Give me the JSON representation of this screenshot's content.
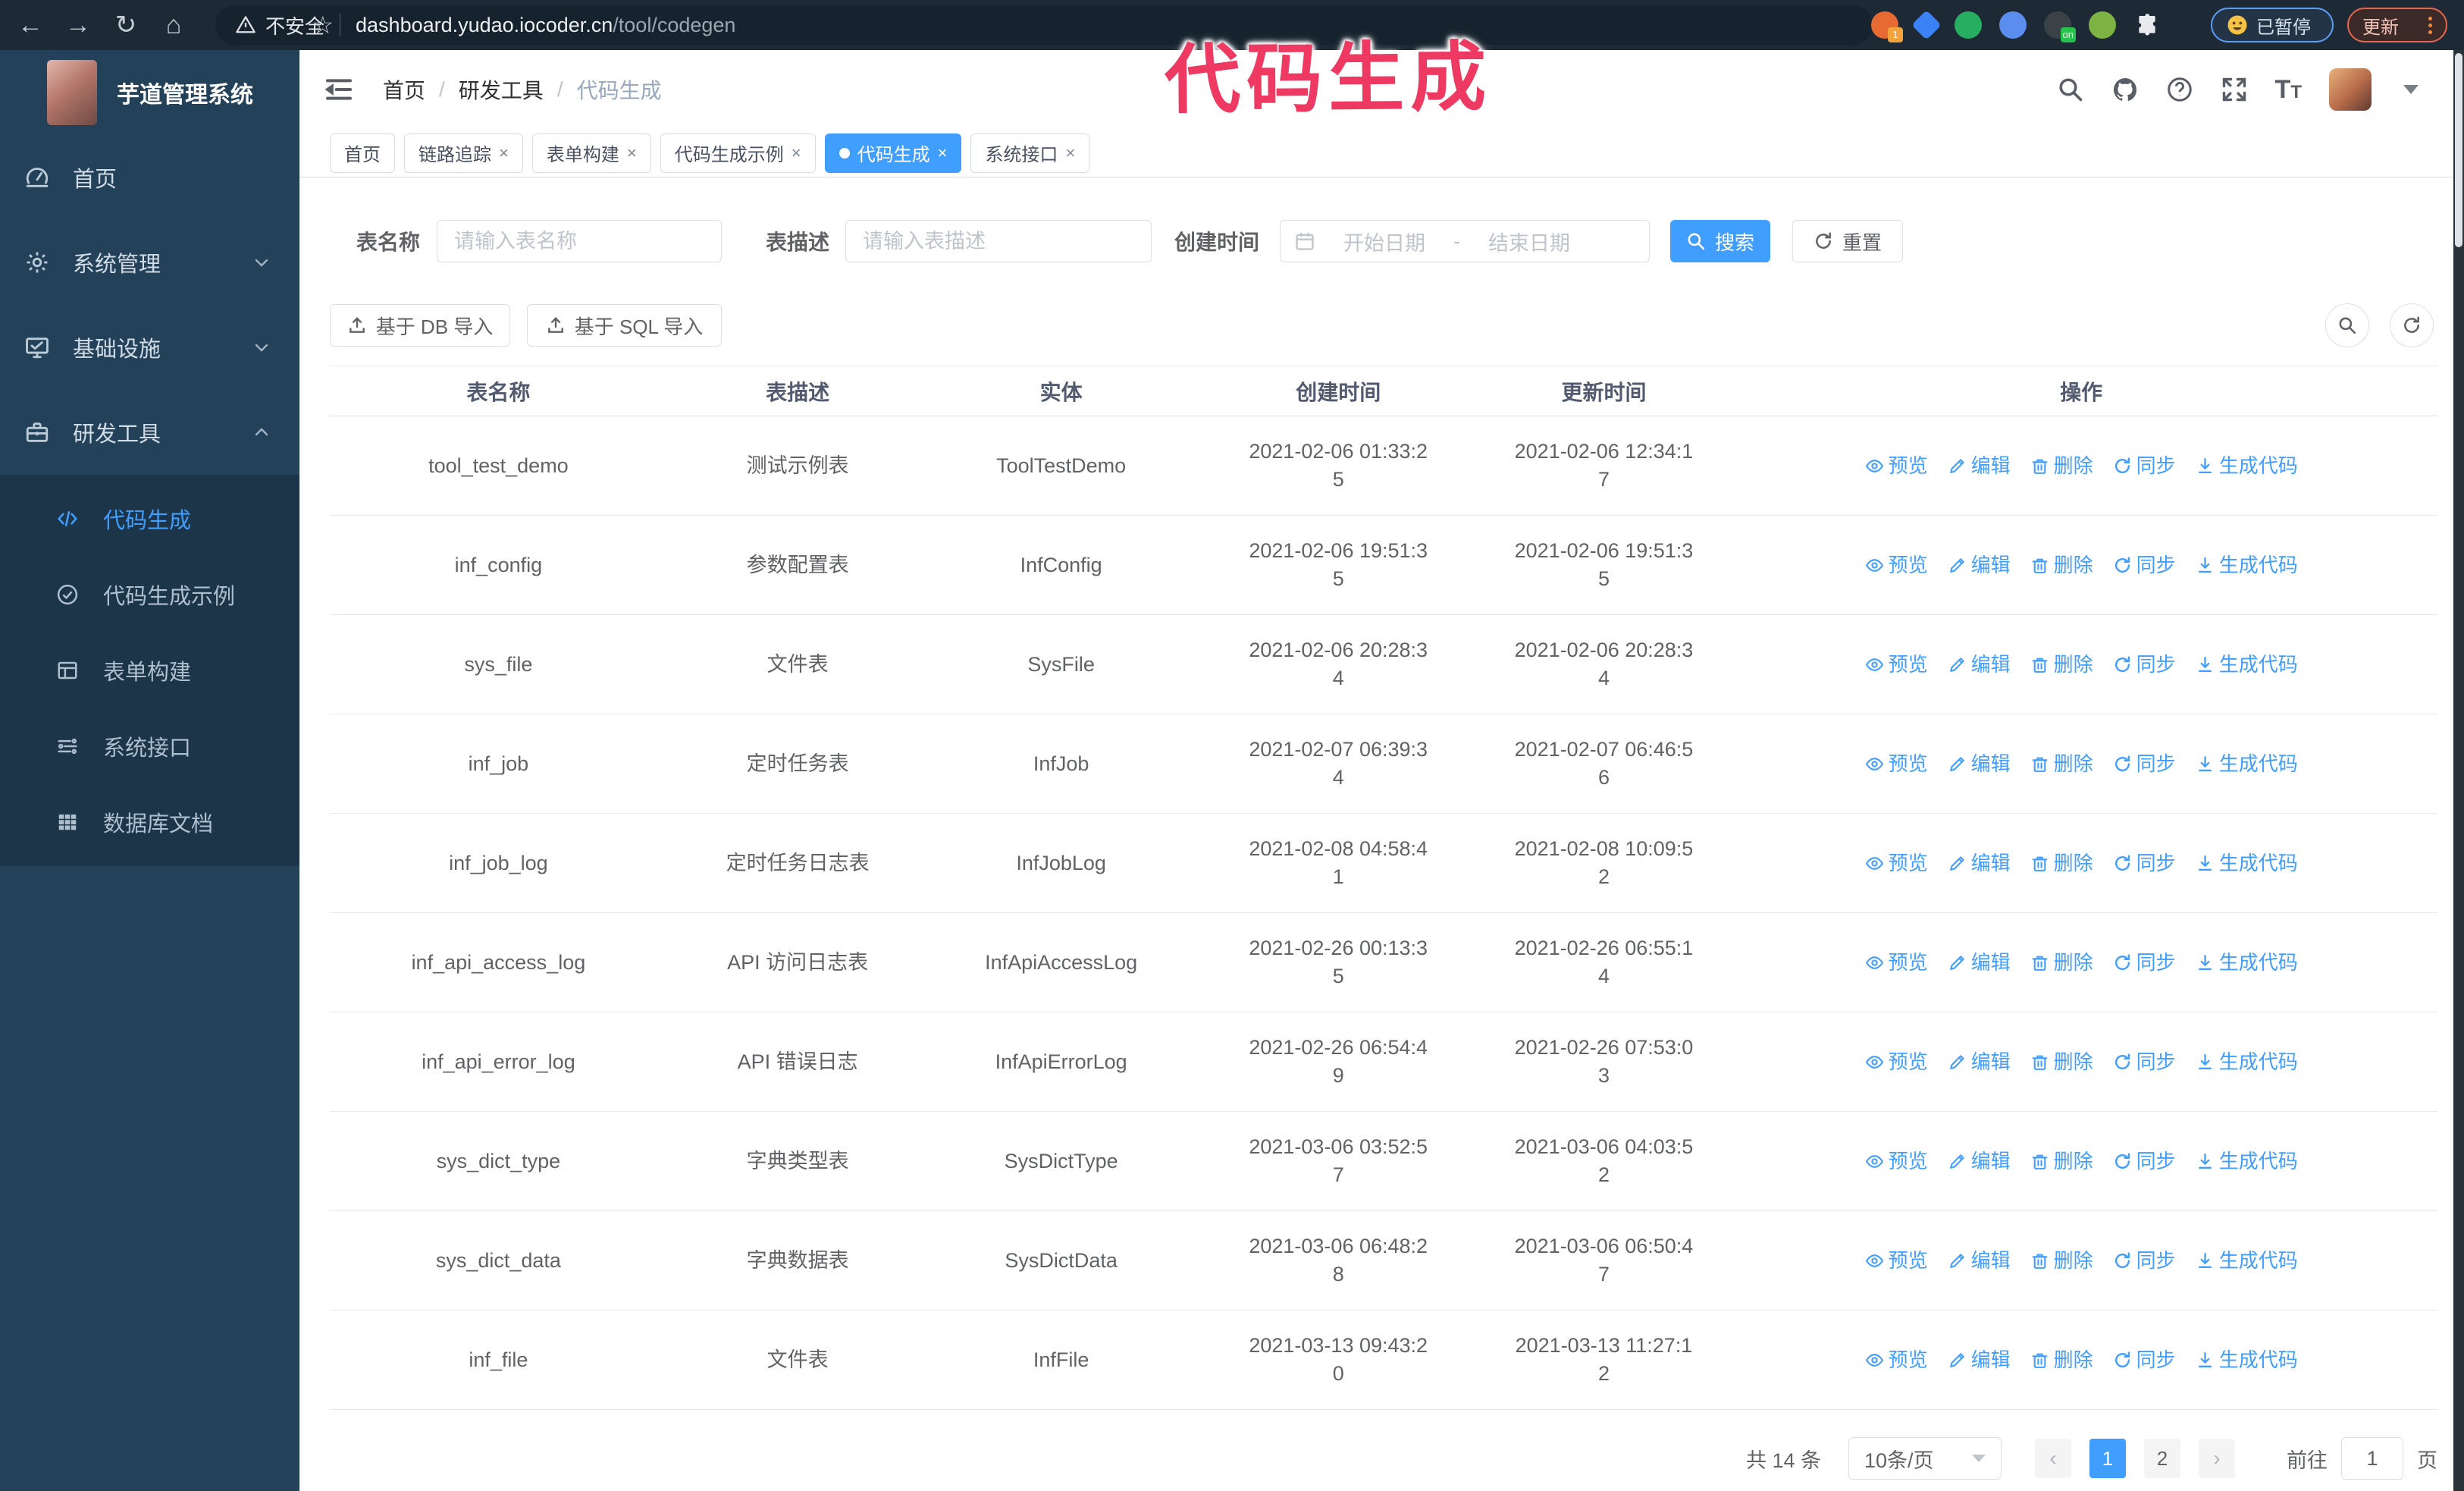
{
  "browser": {
    "security_label": "不安全",
    "url_host": "dashboard.yudao.iocoder.cn",
    "url_path": "/tool/codegen",
    "paused_badge": "已暂停",
    "update_button": "更新",
    "extension_icons": [
      {
        "name": "orange-circle-extension-icon",
        "color": "#e86a33",
        "badge": "1",
        "badge_color": "#f2a33c"
      },
      {
        "name": "blue-gem-extension-icon",
        "color": "#3b82f6",
        "badge": "",
        "badge_color": ""
      },
      {
        "name": "green-check-extension-icon",
        "color": "#27ae60",
        "badge": "",
        "badge_color": ""
      },
      {
        "name": "blue-grid-extension-icon",
        "color": "#5b8def",
        "badge": "",
        "badge_color": ""
      },
      {
        "name": "dark-proxy-extension-icon",
        "color": "#3a4248",
        "badge": "on",
        "badge_color": "#27c24c"
      },
      {
        "name": "green-robot-extension-icon",
        "color": "#7cb342",
        "badge": "",
        "badge_color": ""
      },
      {
        "name": "puzzle-extensions-icon",
        "color": "#e8eaed",
        "badge": "",
        "badge_color": ""
      }
    ]
  },
  "annotation": {
    "text": "代码生成",
    "color": "#ee3a63"
  },
  "sidebar": {
    "app_title": "芋道管理系统",
    "items": [
      {
        "label": "首页"
      },
      {
        "label": "系统管理"
      },
      {
        "label": "基础设施"
      },
      {
        "label": "研发工具"
      }
    ],
    "submenu": [
      {
        "label": "代码生成",
        "active": true
      },
      {
        "label": "代码生成示例"
      },
      {
        "label": "表单构建"
      },
      {
        "label": "系统接口"
      },
      {
        "label": "数据库文档"
      }
    ]
  },
  "header": {
    "breadcrumb": [
      "首页",
      "研发工具",
      "代码生成"
    ]
  },
  "tabs": [
    {
      "label": "首页",
      "active": false,
      "closable": false
    },
    {
      "label": "链路追踪",
      "active": false,
      "closable": true
    },
    {
      "label": "表单构建",
      "active": false,
      "closable": true
    },
    {
      "label": "代码生成示例",
      "active": false,
      "closable": true
    },
    {
      "label": "代码生成",
      "active": true,
      "closable": true
    },
    {
      "label": "系统接口",
      "active": false,
      "closable": true
    }
  ],
  "filters": {
    "name_label": "表名称",
    "name_placeholder": "请输入表名称",
    "desc_label": "表描述",
    "desc_placeholder": "请输入表描述",
    "time_label": "创建时间",
    "start_placeholder": "开始日期",
    "range_separator": "-",
    "end_placeholder": "结束日期",
    "search_label": "搜索",
    "reset_label": "重置"
  },
  "toolbar": {
    "import_db": "基于 DB 导入",
    "import_sql": "基于 SQL 导入"
  },
  "table": {
    "columns": [
      "表名称",
      "表描述",
      "实体",
      "创建时间",
      "更新时间",
      "操作"
    ],
    "actions": [
      "预览",
      "编辑",
      "删除",
      "同步",
      "生成代码"
    ],
    "action_icons": [
      "eye-icon",
      "edit-icon",
      "trash-icon",
      "sync-icon",
      "download-icon"
    ],
    "action_names": [
      "action-preview",
      "action-edit",
      "action-delete",
      "action-sync",
      "action-generate-code"
    ],
    "rows": [
      {
        "name": "tool_test_demo",
        "desc": "测试示例表",
        "entity": "ToolTestDemo",
        "create_time": "2021-02-06 01:33:25",
        "update_time": "2021-02-06 12:34:17"
      },
      {
        "name": "inf_config",
        "desc": "参数配置表",
        "entity": "InfConfig",
        "create_time": "2021-02-06 19:51:35",
        "update_time": "2021-02-06 19:51:35"
      },
      {
        "name": "sys_file",
        "desc": "文件表",
        "entity": "SysFile",
        "create_time": "2021-02-06 20:28:34",
        "update_time": "2021-02-06 20:28:34"
      },
      {
        "name": "inf_job",
        "desc": "定时任务表",
        "entity": "InfJob",
        "create_time": "2021-02-07 06:39:34",
        "update_time": "2021-02-07 06:46:56"
      },
      {
        "name": "inf_job_log",
        "desc": "定时任务日志表",
        "entity": "InfJobLog",
        "create_time": "2021-02-08 04:58:41",
        "update_time": "2021-02-08 10:09:52"
      },
      {
        "name": "inf_api_access_log",
        "desc": "API 访问日志表",
        "entity": "InfApiAccessLog",
        "create_time": "2021-02-26 00:13:35",
        "update_time": "2021-02-26 06:55:14"
      },
      {
        "name": "inf_api_error_log",
        "desc": "API 错误日志",
        "entity": "InfApiErrorLog",
        "create_time": "2021-02-26 06:54:49",
        "update_time": "2021-02-26 07:53:03"
      },
      {
        "name": "sys_dict_type",
        "desc": "字典类型表",
        "entity": "SysDictType",
        "create_time": "2021-03-06 03:52:57",
        "update_time": "2021-03-06 04:03:52"
      },
      {
        "name": "sys_dict_data",
        "desc": "字典数据表",
        "entity": "SysDictData",
        "create_time": "2021-03-06 06:48:28",
        "update_time": "2021-03-06 06:50:47"
      },
      {
        "name": "inf_file",
        "desc": "文件表",
        "entity": "InfFile",
        "create_time": "2021-03-13 09:43:20",
        "update_time": "2021-03-13 11:27:12"
      }
    ]
  },
  "pagination": {
    "total_text": "共 14 条",
    "page_size": "10条/页",
    "prev_label": "‹",
    "next_label": "›",
    "pages": [
      "1",
      "2"
    ],
    "active_page": "1",
    "goto_label": "前往",
    "goto_value": "1",
    "page_unit": "页"
  },
  "colors": {
    "accent": "#409eff",
    "sidebar_bg": "#23425a",
    "submenu_bg": "#1c3549",
    "annotation": "#ee3a63"
  }
}
